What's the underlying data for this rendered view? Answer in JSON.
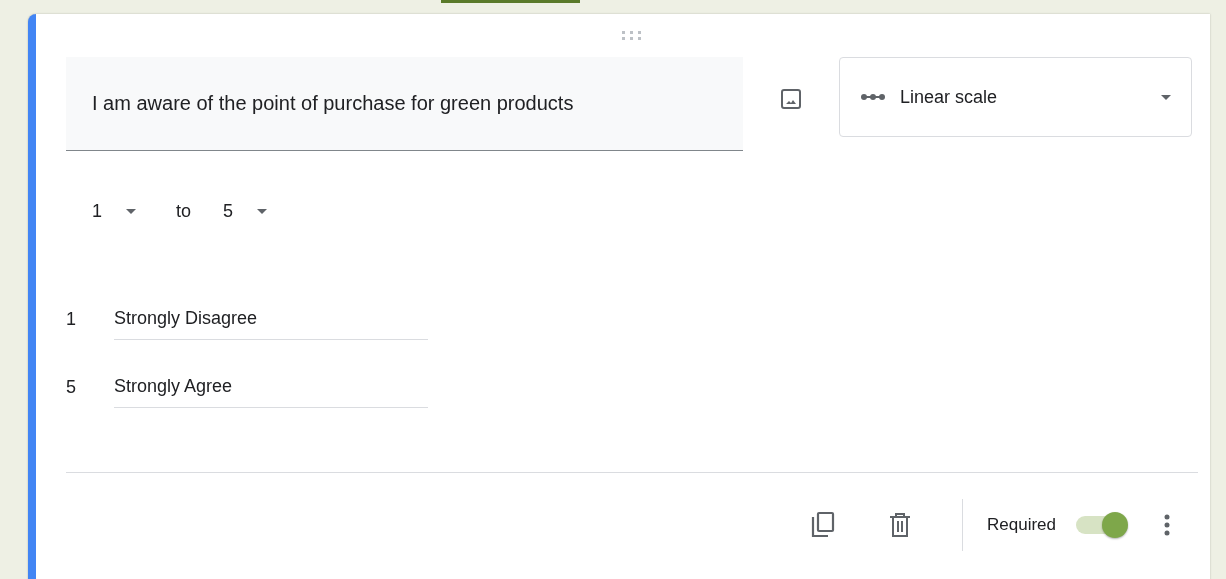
{
  "question": {
    "title": "I am aware of the point of purchase for green products",
    "type": "Linear scale"
  },
  "scale": {
    "from": "1",
    "connector": "to",
    "to": "5"
  },
  "labels": [
    {
      "number": "1",
      "value": "Strongly Disagree"
    },
    {
      "number": "5",
      "value": "Strongly Agree"
    }
  ],
  "footer": {
    "required_label": "Required",
    "required": true
  }
}
